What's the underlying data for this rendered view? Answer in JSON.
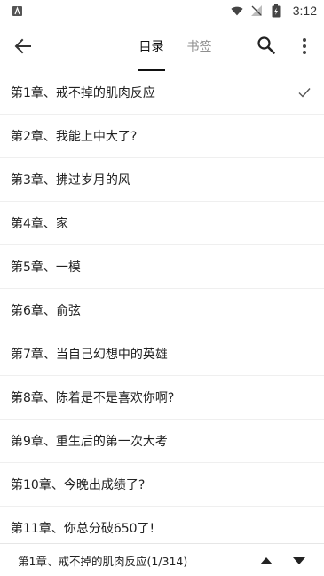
{
  "status": {
    "time": "3:12"
  },
  "tabs": [
    {
      "label": "目录",
      "active": true
    },
    {
      "label": "书签",
      "active": false
    }
  ],
  "chapters": [
    {
      "title": "第1章、戒不掉的肌肉反应",
      "current": true
    },
    {
      "title": "第2章、我能上中大了?",
      "current": false
    },
    {
      "title": "第3章、拂过岁月的风",
      "current": false
    },
    {
      "title": "第4章、家",
      "current": false
    },
    {
      "title": "第5章、一模",
      "current": false
    },
    {
      "title": "第6章、俞弦",
      "current": false
    },
    {
      "title": "第7章、当自己幻想中的英雄",
      "current": false
    },
    {
      "title": "第8章、陈着是不是喜欢你啊?",
      "current": false
    },
    {
      "title": "第9章、重生后的第一次大考",
      "current": false
    },
    {
      "title": "第10章、今晚出成绩了?",
      "current": false
    },
    {
      "title": "第11章、你总分破650了!",
      "current": false
    }
  ],
  "footer": {
    "current_label": "第1章、戒不掉的肌肉反应(1/314)"
  }
}
